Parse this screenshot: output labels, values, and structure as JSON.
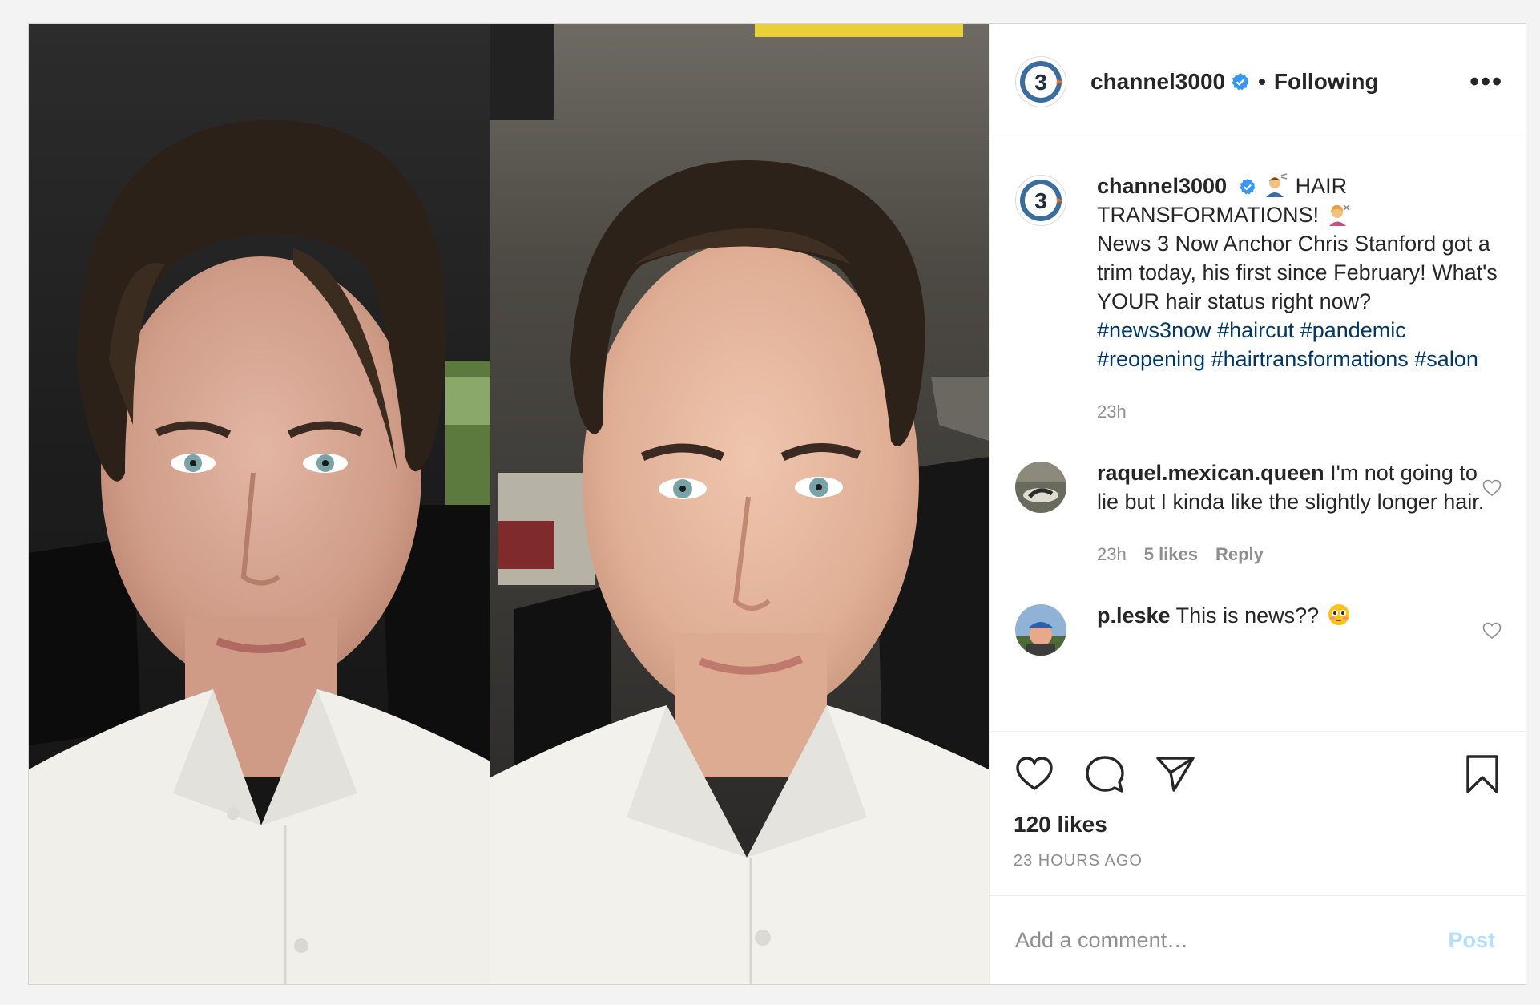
{
  "post": {
    "author": "channel3000",
    "follow_separator": "•",
    "follow_status": "Following",
    "more_label": "•••",
    "verified_icon": "verified-badge-icon",
    "accent_verified": "#3897f0",
    "link_color": "#00376b"
  },
  "caption": {
    "username": "channel3000",
    "title_line": "HAIR TRANSFORMATIONS!",
    "body": "News 3 Now Anchor Chris Stanford got a trim today, his first since February! What's YOUR hair status right now?",
    "hashtags": [
      "#news3now",
      "#haircut",
      "#pandemic",
      "#reopening",
      "#hairtransformations",
      "#salon"
    ],
    "time": "23h"
  },
  "comments": [
    {
      "username": "raquel.mexican.queen",
      "text": "I'm not going to lie but I kinda like the slightly longer hair.",
      "time": "23h",
      "likes": "5 likes",
      "reply": "Reply"
    },
    {
      "username": "p.leske",
      "text": "This is news??"
    }
  ],
  "stats": {
    "likes": "120 likes",
    "timestamp": "23 HOURS AGO"
  },
  "composer": {
    "placeholder": "Add a comment…",
    "post_label": "Post"
  }
}
